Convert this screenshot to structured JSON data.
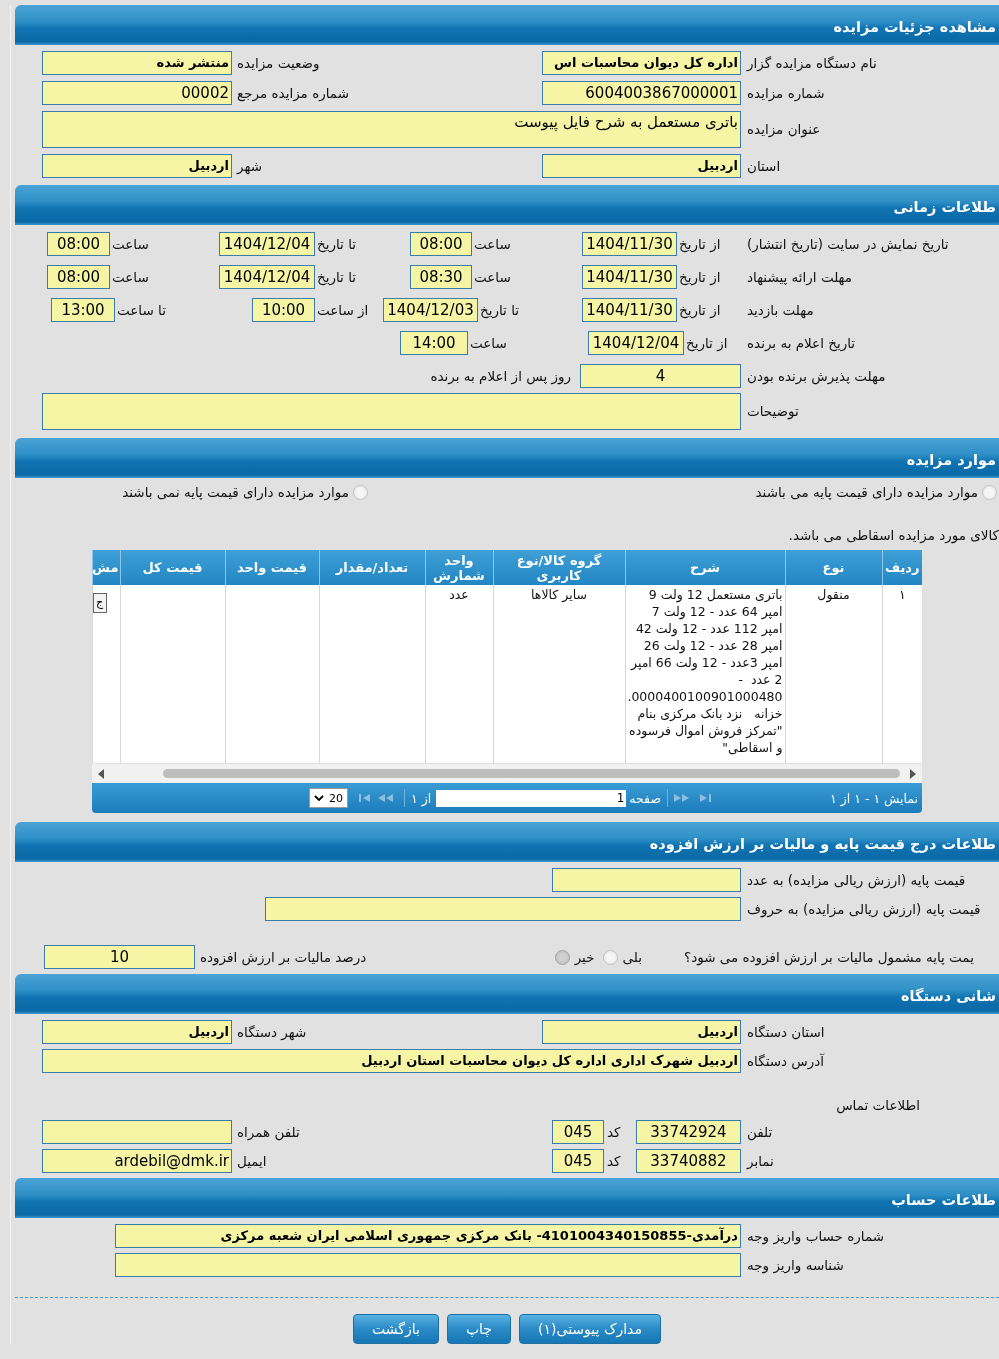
{
  "details": {
    "title": "مشاهده جزئیات مزایده",
    "rows": [
      {
        "fields": [
          {
            "kind": "text",
            "label": "نام دستگاه مزایده گزار",
            "value": "اداره کل دیوان محاسبات اس",
            "bold": true
          },
          {
            "kind": "text",
            "label": "وضعیت مزایده",
            "value": "منتشر شده",
            "bold": true
          }
        ]
      },
      {
        "fields": [
          {
            "kind": "text",
            "label": "شماره مزایده",
            "value": "6004003867000001",
            "bold": false
          },
          {
            "kind": "text",
            "label": "شماره مزایده مرجع",
            "value": "00002",
            "bold": false
          }
        ]
      },
      {
        "fields": [
          {
            "kind": "textarea",
            "label": "عنوان مزایده",
            "value": "باتری مستعمل به شرح فایل پیوست",
            "bold": false
          }
        ]
      },
      {
        "fields": [
          {
            "kind": "text",
            "label": "استان",
            "value": "اردبیل",
            "bold": true
          },
          {
            "kind": "text",
            "label": "شهر",
            "value": "اردبیل",
            "bold": true
          }
        ]
      }
    ]
  },
  "schedule": {
    "title": "طلاعات زمانی",
    "rows": [
      {
        "label": "تاریخ نمایش در سایت (تاریخ انتشار)",
        "cells": [
          {
            "label": "از تاریخ",
            "value": "1404/11/30"
          },
          {
            "label": "ساعت",
            "value": "08:00"
          },
          {
            "label": "تا تاریخ",
            "value": "1404/12/04"
          },
          {
            "label": "ساعت",
            "value": "08:00"
          }
        ]
      },
      {
        "label": "مهلت ارائه پیشنهاد",
        "cells": [
          {
            "label": "از تاریخ",
            "value": "1404/11/30"
          },
          {
            "label": "ساعت",
            "value": "08:30"
          },
          {
            "label": "تا تاریخ",
            "value": "1404/12/04"
          },
          {
            "label": "ساعت",
            "value": "08:00"
          }
        ]
      },
      {
        "label": "مهلت بازدید",
        "cells": [
          {
            "label": "از تاریخ",
            "value": "1404/11/30"
          },
          {
            "label": "تا تاریخ",
            "value": "1404/12/03"
          },
          {
            "label": "از ساعت",
            "value": "10:00"
          },
          {
            "label": "تا ساعت",
            "value": "13:00"
          }
        ]
      },
      {
        "label": "تاریخ اعلام به برنده",
        "cells": [
          {
            "label": "از تاریخ",
            "value": "1404/12/04"
          },
          {
            "label": "ساعت",
            "value": "14:00"
          }
        ]
      }
    ],
    "acceptance": {
      "label": "مهلت پذیرش برنده بودن",
      "value": "4",
      "suffix": "روز پس از اعلام به برنده"
    },
    "notes": {
      "label": "توضیحات"
    }
  },
  "items": {
    "title": "موارد مزایده",
    "options": [
      {
        "label": "موارد مزایده دارای قیمت پایه می باشند",
        "selected": false
      },
      {
        "label": "موارد مزایده دارای قیمت پایه نمی باشند",
        "selected": false
      }
    ],
    "note": "کالای مورد مزایده اسقاطی می باشد.",
    "table": {
      "columns": [
        "ردیف",
        "نوع",
        "شرح",
        "گروه کالا/نوع کاربری",
        "واحد شمارش",
        "تعداد/مقدار",
        "قیمت واحد",
        "قیمت کل",
        "مش"
      ],
      "rows": [
        {
          "number": "۱",
          "type": "منقول",
          "description": "باتری مستعمل 12 ولت 9 امپر 64 عدد - 12 ولت 7 امپر 112 عدد - 12 ولت 42 امپر 28 عدد - 12 ولت 26 امپر 3عدد - 12 ولت 66 امپر 2 عدد  - 0000400100901000480. خزانه   نزد بانک مرکزی بنام \"تمرکز فروش اموال فرسوده و اسقاطی\"",
          "group": "سایر کالاها",
          "unit": "عدد",
          "action": "ج"
        }
      ]
    },
    "pager": {
      "summary": "نمایش ۱ - ۱ از ۱",
      "page_label": "صفحه",
      "page": "1",
      "total": "از ۱",
      "page_size": "20"
    }
  },
  "pricing": {
    "title": "طلاعات درج قیمت پایه و مالیات بر ارزش افزوده",
    "fields": [
      {
        "label": "قیمت پایه (ارزش ریالی مزایده) به عدد"
      },
      {
        "label": "قیمت پایه (ارزش ریالی مزایده) به حروف"
      }
    ],
    "vat": {
      "question": "یمت پایه مشمول مالیات بر ارزش افزوده می شود؟",
      "options": [
        {
          "label": "بلی",
          "selected": false
        },
        {
          "label": "خیر",
          "selected": true
        }
      ],
      "rate": {
        "label": "درصد مالیات بر ارزش افزوده",
        "value": "10"
      }
    }
  },
  "device": {
    "title": "شانی دستگاه",
    "rows": [
      {
        "fields": [
          {
            "kind": "text",
            "label": "استان دستگاه",
            "value": "اردبیل",
            "bold": true
          },
          {
            "kind": "text",
            "label": "شهر دستگاه",
            "value": "اردبیل",
            "bold": true
          }
        ]
      },
      {
        "fields": [
          {
            "kind": "text",
            "label": "آدرس دستگاه",
            "value": "اردبیل شهرک اداری اداره کل دیوان محاسبات استان اردبیل",
            "bold": true
          }
        ]
      }
    ],
    "contact_heading": "اطلاعات تماس",
    "contacts": [
      {
        "label": "تلفن",
        "number": "33742924",
        "code_label": "کد",
        "code": "045",
        "other": {
          "label": "تلفن همراه"
        }
      },
      {
        "label": "نمابر",
        "number": "33740882",
        "code_label": "کد",
        "code": "045",
        "other": {
          "label": "ایمیل",
          "value": "ardebil@dmk.ir"
        }
      }
    ]
  },
  "account": {
    "title": "طلاعات حساب",
    "fields": [
      {
        "label": "شماره حساب واریز وجه",
        "value": "درآمدی-4101004340150855- بانک مرکزی جمهوری اسلامی ایران شعبه مرکزی",
        "bold": true
      },
      {
        "label": "شناسه واریز وجه"
      }
    ]
  },
  "buttons": [
    "مدارک پیوستی(۱)",
    "چاپ",
    "بازگشت"
  ]
}
